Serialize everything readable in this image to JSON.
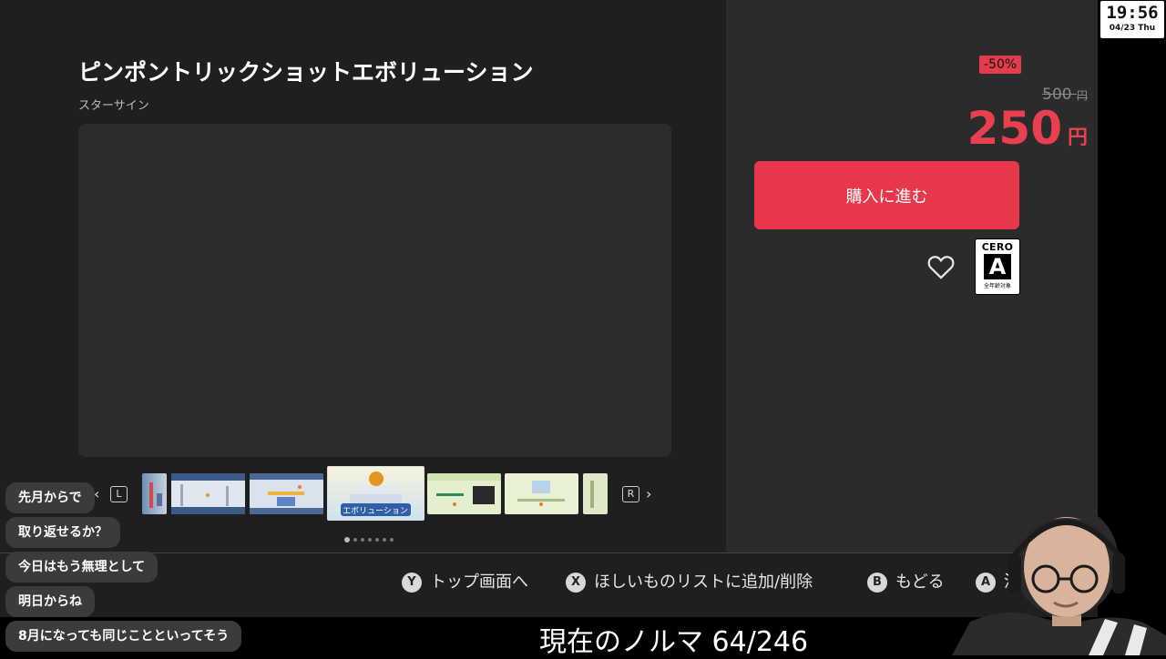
{
  "game": {
    "title": "ピンポントリックショットエボリューション",
    "publisher": "スターサイン"
  },
  "pricing": {
    "discount": "-50%",
    "original_price": "500",
    "original_currency": "円",
    "sale_price": "250",
    "sale_currency": "円",
    "buy_label": "購入に進む",
    "accent_color": "#e8374a"
  },
  "rating": {
    "org": "CERO",
    "grade": "A",
    "caption": "全年齢対象"
  },
  "media_strip": {
    "left_shoulder": "L",
    "right_shoulder": "R",
    "thumbnail_count": 7,
    "active_index": 3,
    "active_caption": "エボリューション"
  },
  "footer": {
    "buttons": [
      {
        "key": "Y",
        "label": "トップ画面へ"
      },
      {
        "key": "X",
        "label": "ほしいものリストに追加/削除"
      },
      {
        "key": "B",
        "label": "もどる"
      },
      {
        "key": "A",
        "label": "決"
      }
    ]
  },
  "clock": {
    "time": "19:56",
    "date": "04/23 Thu"
  },
  "chat": {
    "messages": [
      "先月からで",
      "取り返せるか？",
      "今日はもう無理として",
      "明日からね",
      "8月になっても同じことといってそう"
    ]
  },
  "overlay": {
    "subtitle": "現在のノルマ 64/246"
  }
}
